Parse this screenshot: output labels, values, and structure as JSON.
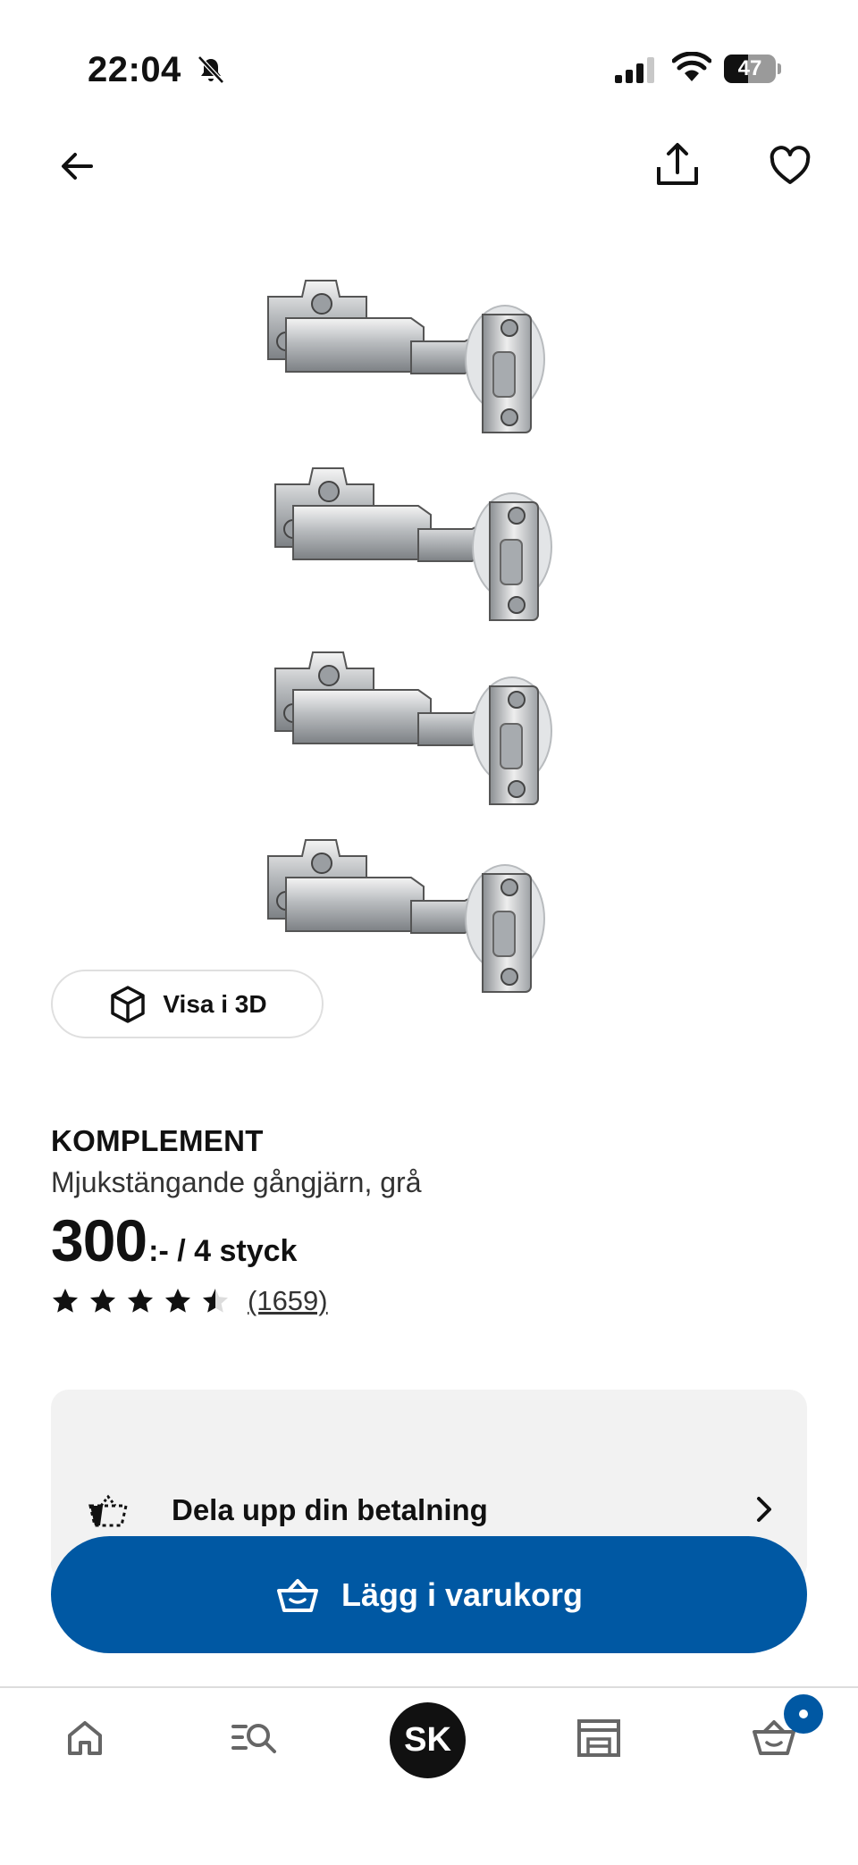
{
  "status_bar": {
    "time": "22:04",
    "battery_level": "47",
    "battery_fraction": 0.47,
    "icons": [
      "bell-muted-icon",
      "cellular-signal-icon",
      "wifi-icon",
      "battery-icon"
    ]
  },
  "top_nav": {
    "icons": [
      "back-arrow-icon",
      "share-icon",
      "heart-icon"
    ]
  },
  "view_3d": {
    "label": "Visa i 3D",
    "icon": "cube-3d-icon"
  },
  "product": {
    "name": "KOMPLEMENT",
    "description": "Mjukstängande gångjärn, grå",
    "price": "300",
    "price_unit": ":- / 4 styck",
    "rating": 4.5,
    "rating_max": 5,
    "review_count": "(1659)"
  },
  "payment": {
    "label": "Dela upp din betalning",
    "icon": "installment-basket-icon"
  },
  "add_to_cart": {
    "label": "Lägg i varukorg",
    "icon": "basket-icon"
  },
  "tab_bar": {
    "profile_initials": "SK",
    "icons": [
      "home-icon",
      "search-list-icon",
      "store-icon",
      "cart-icon"
    ]
  },
  "colors": {
    "ikea_blue": "#0058a3",
    "card_bg": "#f2f2f2",
    "text": "#111111"
  }
}
